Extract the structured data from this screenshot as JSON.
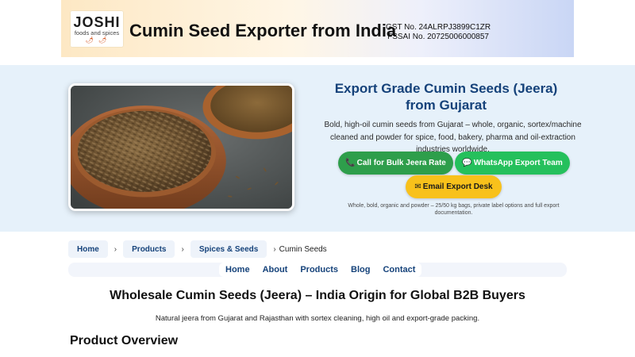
{
  "header": {
    "logo": {
      "name": "JOSHI",
      "tagline": "foods and spices"
    },
    "site_title": "Cumin Seed Exporter from India",
    "gst": "GST No. 24ALRPJ3899C1ZR",
    "fssai": "FSSAI No. 20725006000857"
  },
  "hero": {
    "image_alt": "cumin seeds and cumin powder in wooden bowls",
    "title": "Export Grade Cumin Seeds (Jeera) from Gujarat",
    "description": "Bold, high-oil cumin seeds from Gujarat – whole, organic, sortex/machine cleaned and powder for spice, food, bakery, pharma and oil-extraction industries worldwide.",
    "buttons": {
      "call": {
        "icon": "phone-icon",
        "label": "Call for Bulk Jeera Rate"
      },
      "whatsapp": {
        "icon": "chat-icon",
        "label": "WhatsApp Export Team"
      },
      "email": {
        "icon": "envelope-icon",
        "label": "Email Export Desk"
      }
    },
    "note": "Whole, bold, organic and powder – 25/50 kg bags, private label options and full export documentation."
  },
  "breadcrumb": {
    "items": [
      "Home",
      "Products",
      "Spices & Seeds"
    ],
    "separator": "›",
    "current": "Cumin Seeds"
  },
  "nav": {
    "items": [
      "Home",
      "About",
      "Products",
      "Blog",
      "Contact"
    ]
  },
  "main": {
    "title": "Wholesale Cumin Seeds (Jeera) – India Origin for Global B2B Buyers",
    "subtitle": "Natural jeera from Gujarat and Rajasthan with sortex cleaning, high oil and export-grade packing.",
    "section_title": "Product Overview"
  },
  "colors": {
    "primary_blue": "#15427a",
    "call_green": "#2e9e4b",
    "whatsapp_green": "#25c05c",
    "email_yellow": "#f8c11b",
    "hero_bg": "#e6f1fa"
  }
}
